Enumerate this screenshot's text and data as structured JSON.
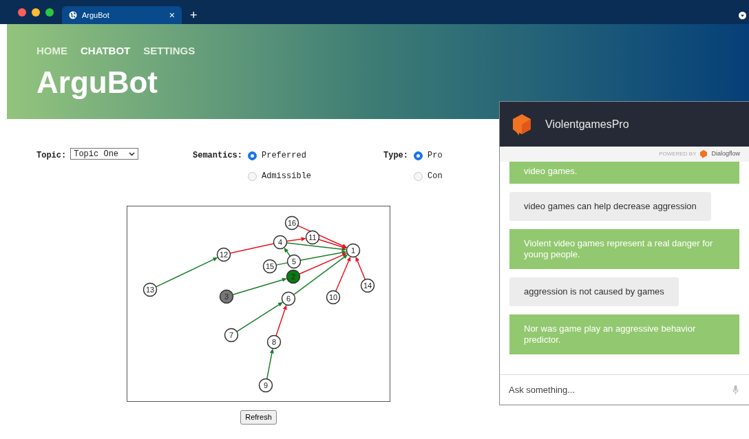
{
  "browser": {
    "tabs": [
      {
        "title": "ArguBot",
        "close": "×",
        "selected": true
      }
    ],
    "new_tab": "+"
  },
  "nav": [
    {
      "label": "HOME",
      "selected": false
    },
    {
      "label": "CHATBOT",
      "selected": true
    },
    {
      "label": "SETTINGS",
      "selected": false
    }
  ],
  "title": "ArguBot",
  "controls": {
    "topic": {
      "label": "Topic:",
      "value": "Topic One"
    },
    "semantics": {
      "label": "Semantics:",
      "options": [
        {
          "label": "Preferred",
          "selected": true
        },
        {
          "label": "Admissible",
          "selected": false
        }
      ]
    },
    "type": {
      "label": "Type:",
      "options": [
        {
          "label": "Pro",
          "selected": true
        },
        {
          "label": "Con",
          "selected": false
        }
      ]
    }
  },
  "graph": {
    "nodes": [
      {
        "label": "1",
        "kind": "plain"
      },
      {
        "label": "2",
        "kind": "accepted"
      },
      {
        "label": "3",
        "kind": "rejected"
      },
      {
        "label": "4",
        "kind": "plain"
      },
      {
        "label": "5",
        "kind": "plain"
      },
      {
        "label": "6",
        "kind": "plain"
      },
      {
        "label": "7",
        "kind": "plain"
      },
      {
        "label": "8",
        "kind": "plain"
      },
      {
        "label": "9",
        "kind": "plain"
      },
      {
        "label": "10",
        "kind": "plain"
      },
      {
        "label": "11",
        "kind": "plain"
      },
      {
        "label": "12",
        "kind": "plain"
      },
      {
        "label": "13",
        "kind": "plain"
      },
      {
        "label": "14",
        "kind": "plain"
      },
      {
        "label": "15",
        "kind": "plain"
      },
      {
        "label": "16",
        "kind": "plain"
      }
    ],
    "edges": [
      {
        "kind": "support",
        "directed": true
      },
      {
        "kind": "attack",
        "directed": false
      },
      {
        "kind": "attack",
        "directed": true
      },
      {
        "kind": "support",
        "directed": true
      },
      {
        "kind": "attack",
        "directed": true
      },
      {
        "kind": "attack",
        "directed": true
      },
      {
        "kind": "support",
        "directed": true
      },
      {
        "kind": "support",
        "directed": true
      },
      {
        "kind": "support",
        "directed": false
      },
      {
        "kind": "attack",
        "directed": true
      },
      {
        "kind": "support",
        "directed": true
      },
      {
        "kind": "support",
        "directed": true
      },
      {
        "kind": "support",
        "directed": true
      },
      {
        "kind": "attack",
        "directed": true
      },
      {
        "kind": "support",
        "directed": true
      },
      {
        "kind": "attack",
        "directed": true
      },
      {
        "kind": "attack",
        "directed": true
      }
    ]
  },
  "refresh": "Refresh",
  "chat": {
    "title": "ViolentgamesPro",
    "powered_by": "POWERED BY",
    "brand": "Dialogflow",
    "messages": [
      {
        "kind": "bot",
        "text": "video games."
      },
      {
        "kind": "user",
        "text": "video games can help decrease aggression"
      },
      {
        "kind": "bot",
        "text": "Violent video games represent a real danger for young people."
      },
      {
        "kind": "user",
        "text": "aggression is not caused by games"
      },
      {
        "kind": "bot",
        "text": "Nor was game play an aggressive behavior predictor."
      }
    ],
    "input": {
      "placeholder": "Ask something..."
    }
  }
}
